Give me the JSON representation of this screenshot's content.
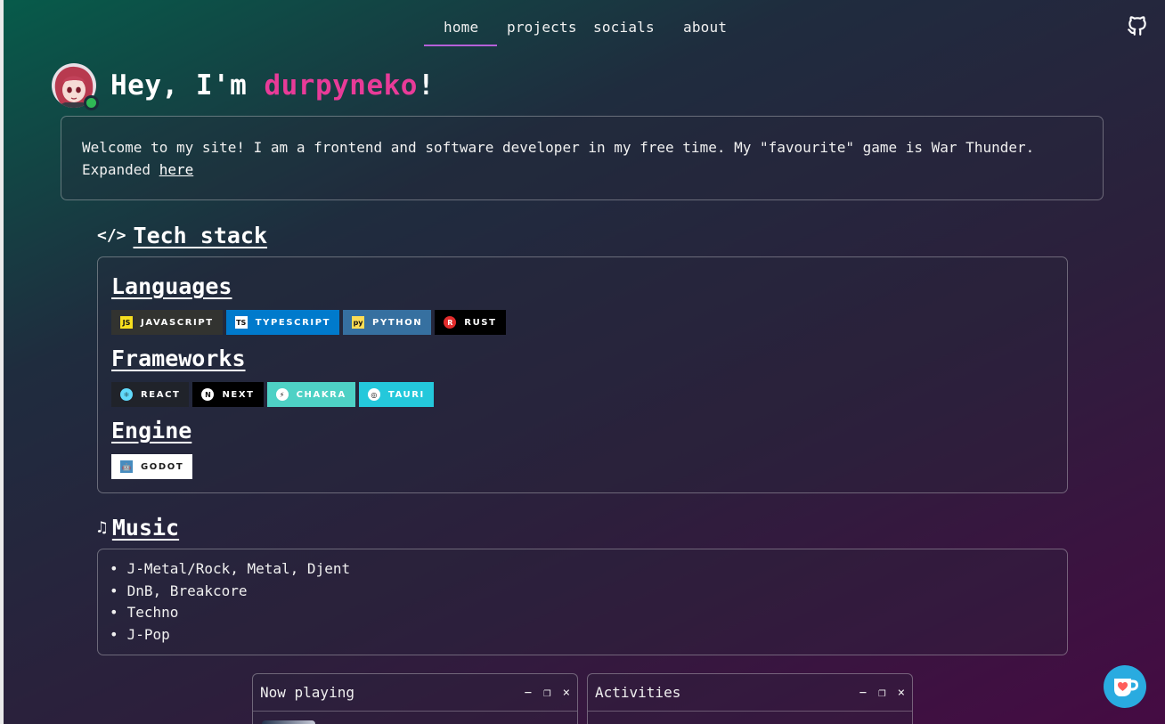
{
  "nav": {
    "items": [
      {
        "label": "home",
        "active": true
      },
      {
        "label": "projects",
        "active": false
      },
      {
        "label": "socials",
        "active": false
      },
      {
        "label": "about",
        "active": false
      }
    ],
    "github_icon": "github-icon"
  },
  "hero": {
    "greeting": "Hey, I'm ",
    "name": "durpyneko",
    "exclamation": "!",
    "status": "online"
  },
  "intro": {
    "text": "Welcome to my site! I am a frontend and software developer in my free time. My \"favourite\" game is War Thunder. Expanded ",
    "link": "here"
  },
  "tech_stack": {
    "heading_icon": "</>",
    "heading": "Tech stack",
    "groups": [
      {
        "title": "Languages",
        "badges": [
          {
            "label": "JAVASCRIPT",
            "bg": "#323330",
            "logo": "JS",
            "logo_bg": "#f7df1e"
          },
          {
            "label": "TYPESCRIPT",
            "bg": "#007acc",
            "logo": "TS",
            "logo_bg": "#ffffff"
          },
          {
            "label": "PYTHON",
            "bg": "#3670a0",
            "logo": "py",
            "logo_bg": "#ffdd54"
          },
          {
            "label": "RUST",
            "bg": "#000000",
            "logo": "R",
            "logo_bg": "#e32c2c"
          }
        ]
      },
      {
        "title": "Frameworks",
        "badges": [
          {
            "label": "REACT",
            "bg": "#20232a",
            "logo": "⚛",
            "logo_bg": "#61dafb"
          },
          {
            "label": "NEXT",
            "bg": "#000000",
            "logo": "N",
            "logo_bg": "#ffffff"
          },
          {
            "label": "CHAKRA",
            "bg": "#4ed1c5",
            "logo": "⚡",
            "logo_bg": "#ffffff"
          },
          {
            "label": "TAURI",
            "bg": "#24c8db",
            "logo": "◎",
            "logo_bg": "#ffffff"
          }
        ]
      },
      {
        "title": "Engine",
        "badges": [
          {
            "label": "GODOT",
            "bg": "#ffffff",
            "logo": "🤖",
            "logo_bg": "#478cbf"
          }
        ]
      }
    ]
  },
  "music": {
    "heading_icon": "♫",
    "heading": "Music",
    "items": [
      "J-Metal/Rock, Metal, Djent",
      "DnB, Breakcore",
      "Techno",
      "J-Pop"
    ]
  },
  "windows": [
    {
      "title": "Now playing",
      "controls": [
        "−",
        "❐",
        "×"
      ]
    },
    {
      "title": "Activities",
      "controls": [
        "−",
        "❐",
        "×"
      ]
    }
  ],
  "kofi": {
    "icon": "kofi-cup-icon"
  },
  "colors": {
    "accent_pink": "#e83b98",
    "nav_underline": "#b560d8",
    "online_green": "#2fb955",
    "kofi_blue": "#29abe0"
  }
}
